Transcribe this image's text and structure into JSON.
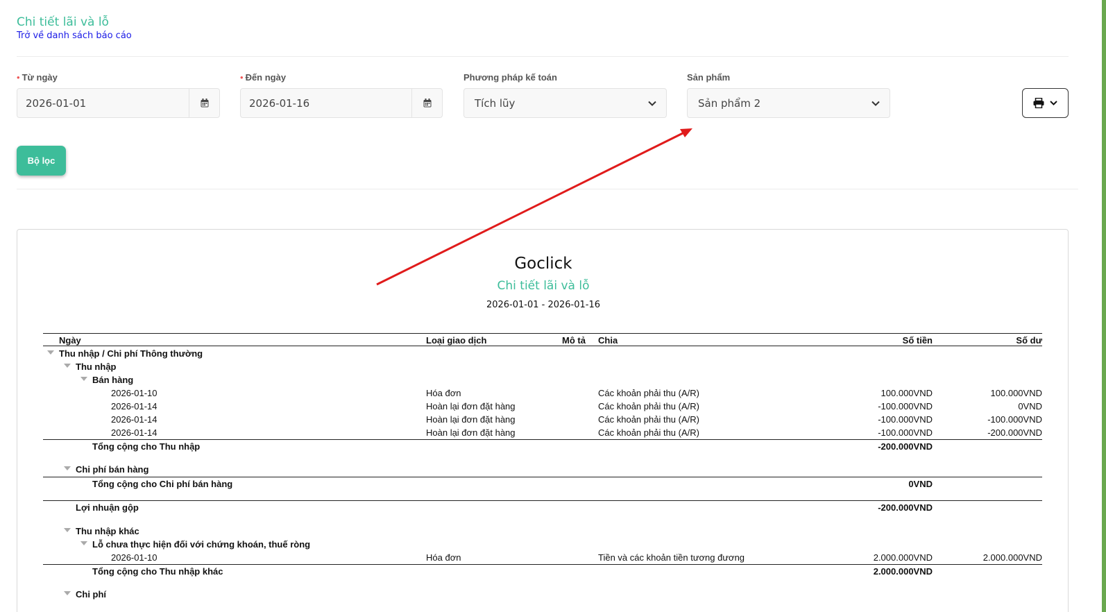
{
  "header": {
    "title": "Chi tiết lãi và lỗ",
    "back_link": "Trở về danh sách báo cáo"
  },
  "filters": {
    "from_date": {
      "label": "Từ ngày",
      "required_mark": "•",
      "value": "2026-01-01"
    },
    "to_date": {
      "label": "Đến ngày",
      "required_mark": "•",
      "value": "2026-01-16"
    },
    "accounting_method": {
      "label": "Phương pháp kế toán",
      "value": "Tích lũy"
    },
    "product": {
      "label": "Sản phẩm",
      "value": "Sản phẩm 2"
    },
    "filter_button": "Bộ lọc"
  },
  "report": {
    "company": "Goclick",
    "title": "Chi tiết lãi và lỗ",
    "range": "2026-01-01 - 2026-01-16",
    "columns": {
      "date": "Ngày",
      "type": "Loại giao dịch",
      "desc": "Mô tả",
      "split": "Chia",
      "amount": "Số tiền",
      "balance": "Số dư"
    },
    "groups": {
      "g1": "Thu nhập / Chi phí Thông thường",
      "income": "Thu nhập",
      "sales": "Bán hàng",
      "income_total": "Tổng cộng cho Thu nhập",
      "income_total_amount": "-200.000VND",
      "selling_exp": "Chi phí bán hàng",
      "selling_exp_total": "Tổng cộng cho Chi phí bán hàng",
      "selling_exp_total_amount": "0VND",
      "gross_profit": "Lợi nhuận gộp",
      "gross_profit_amount": "-200.000VND",
      "other_income": "Thu nhập khác",
      "unrealized": "Lỗ chưa thực hiện đối với chứng khoán, thuế ròng",
      "other_income_total": "Tổng cộng cho Thu nhập khác",
      "other_income_total_amount": "2.000.000VND",
      "expense": "Chi phí"
    },
    "sales_rows": [
      {
        "date": "2026-01-10",
        "type": "Hóa đơn",
        "split": "Các khoản phải thu (A/R)",
        "amount": "100.000VND",
        "balance": "100.000VND"
      },
      {
        "date": "2026-01-14",
        "type": "Hoàn lại đơn đặt hàng",
        "split": "Các khoản phải thu (A/R)",
        "amount": "-100.000VND",
        "balance": "0VND"
      },
      {
        "date": "2026-01-14",
        "type": "Hoàn lại đơn đặt hàng",
        "split": "Các khoản phải thu (A/R)",
        "amount": "-100.000VND",
        "balance": "-100.000VND"
      },
      {
        "date": "2026-01-14",
        "type": "Hoàn lại đơn đặt hàng",
        "split": "Các khoản phải thu (A/R)",
        "amount": "-100.000VND",
        "balance": "-200.000VND"
      }
    ],
    "unrealized_rows": [
      {
        "date": "2026-01-10",
        "type": "Hóa đơn",
        "split": "Tiền và các khoản tiền tương đương",
        "amount": "2.000.000VND",
        "balance": "2.000.000VND"
      }
    ]
  },
  "icons": {
    "calendar": "calendar-icon",
    "chevron": "chevron-down-icon",
    "printer": "printer-icon",
    "collapse": "caret-down-icon"
  },
  "colors": {
    "accent": "#3dbd9a",
    "link": "#1a1ae6",
    "annotation_arrow": "#e01b1b"
  }
}
